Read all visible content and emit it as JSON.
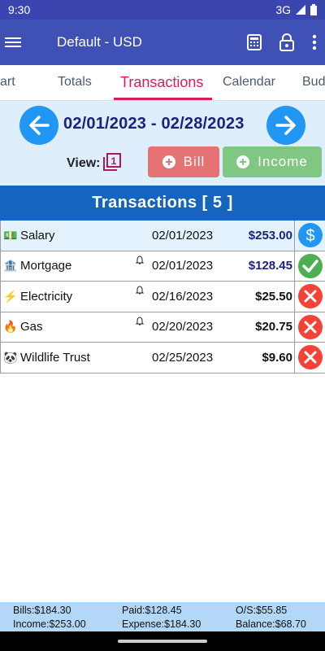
{
  "status": {
    "time": "9:30",
    "network": "3G"
  },
  "app_bar": {
    "title": "Default - USD"
  },
  "tabs": [
    {
      "label": "art",
      "active": false
    },
    {
      "label": "Totals",
      "active": false
    },
    {
      "label": "Transactions",
      "active": true
    },
    {
      "label": "Calendar",
      "active": false
    },
    {
      "label": "Bud",
      "active": false
    }
  ],
  "range": {
    "text": "02/01/2023 - 02/28/2023"
  },
  "view": {
    "label": "View:",
    "value": "1"
  },
  "buttons": {
    "bill": "Bill",
    "income": "Income"
  },
  "list": {
    "header": "Transactions [ 5 ]"
  },
  "transactions": [
    {
      "emoji": "💵",
      "name": "Salary",
      "date": "02/01/2023",
      "amount": "$253.00",
      "reminder": false,
      "status": "income",
      "paid": true
    },
    {
      "emoji": "🏦",
      "name": "Mortgage",
      "date": "02/01/2023",
      "amount": "$128.45",
      "reminder": true,
      "status": "paid",
      "paid": true
    },
    {
      "emoji": "⚡",
      "name": "Electricity",
      "date": "02/16/2023",
      "amount": "$25.50",
      "reminder": true,
      "status": "unpaid",
      "paid": false
    },
    {
      "emoji": "🔥",
      "name": "Gas",
      "date": "02/20/2023",
      "amount": "$20.75",
      "reminder": true,
      "status": "unpaid",
      "paid": false
    },
    {
      "emoji": "🐼",
      "name": "Wildlife Trust",
      "date": "02/25/2023",
      "amount": "$9.60",
      "reminder": false,
      "status": "unpaid",
      "paid": false
    }
  ],
  "summary": {
    "bills": "Bills:$184.30",
    "paid": "Paid:$128.45",
    "os": "O/S:$55.85",
    "income": "Income:$253.00",
    "expense": "Expense:$184.30",
    "balance": "Balance:$68.70"
  },
  "colors": {
    "app_bar": "#3f51b5",
    "accent": "#d81b60",
    "header": "#1565c0",
    "income_button": "#81c784",
    "bill_button": "#e57373",
    "status_income": "#2196f3",
    "status_paid": "#4caf50",
    "status_unpaid": "#f44336"
  },
  "icons": {
    "menu": "hamburger-icon",
    "calculator": "calculator-icon",
    "lock": "lock-icon",
    "more": "more-vert-icon",
    "prev": "arrow-left-icon",
    "next": "arrow-right-icon",
    "view": "view-mode-icon",
    "bell": "bell-icon"
  }
}
